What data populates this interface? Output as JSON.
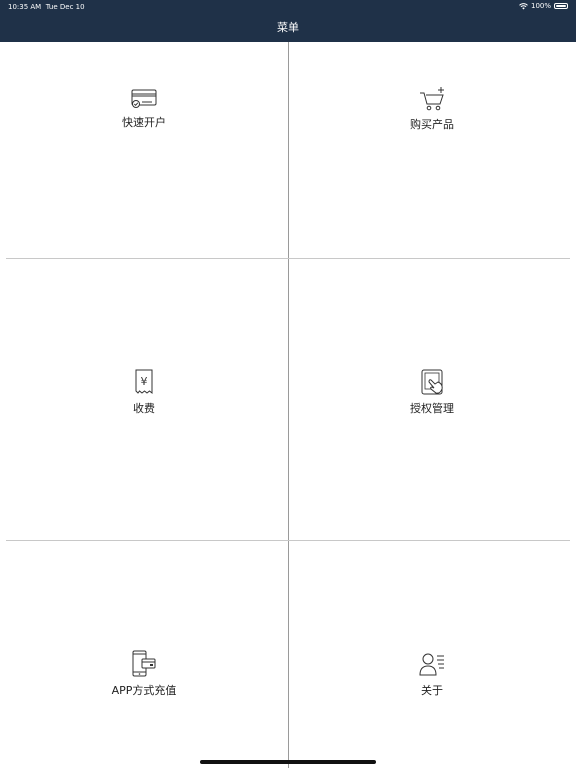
{
  "status_bar": {
    "time": "10:35 AM",
    "date": "Tue Dec 10",
    "battery": "100%"
  },
  "nav": {
    "title": "菜单"
  },
  "menu": [
    {
      "label": "快速开户",
      "icon": "card-check-icon"
    },
    {
      "label": "购买产品",
      "icon": "cart-plus-icon"
    },
    {
      "label": "收费",
      "icon": "yen-receipt-icon"
    },
    {
      "label": "授权管理",
      "icon": "tablet-touch-icon"
    },
    {
      "label": "APP方式充值",
      "icon": "phone-card-icon"
    },
    {
      "label": "关于",
      "icon": "person-list-icon"
    }
  ],
  "colors": {
    "header_bg": "#1f3148",
    "divider": "#c8c8c8",
    "text": "#222222"
  }
}
